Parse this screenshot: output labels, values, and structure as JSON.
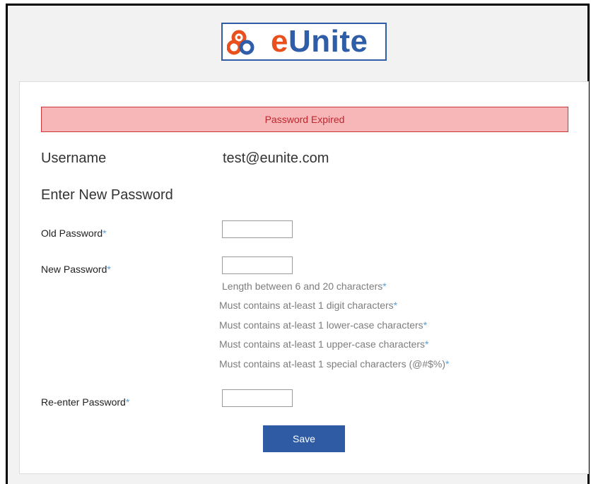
{
  "logo": {
    "text_e": "e",
    "text_rest": "Unite",
    "icon": "eunite-logo-icon"
  },
  "alert": {
    "text": "Password Expired",
    "color": "#c0272d",
    "background": "#f7b6b8"
  },
  "username": {
    "label": "Username",
    "value": "test@eunite.com"
  },
  "section_title": "Enter New Password",
  "form": {
    "old_password": {
      "label": "Old Password",
      "required_mark": "*",
      "value": ""
    },
    "new_password": {
      "label": "New Password",
      "required_mark": "*",
      "value": ""
    },
    "reenter_password": {
      "label": "Re-enter Password",
      "required_mark": "*",
      "value": ""
    }
  },
  "rules": [
    {
      "text": "Length between 6 and 20 characters",
      "mark": "*"
    },
    {
      "text": "Must contains at-least 1 digit characters",
      "mark": "*"
    },
    {
      "text": "Must contains at-least 1 lower-case characters",
      "mark": "*"
    },
    {
      "text": "Must contains at-least 1 upper-case characters",
      "mark": "*"
    },
    {
      "text": "Must contains at-least 1 special characters (@#$%)",
      "mark": "*"
    }
  ],
  "save_button": {
    "label": "Save",
    "color": "#2f5ba5"
  },
  "colors": {
    "brand_blue": "#2f5da8",
    "brand_orange": "#e8501e",
    "required_mark": "#5aa0d8"
  }
}
